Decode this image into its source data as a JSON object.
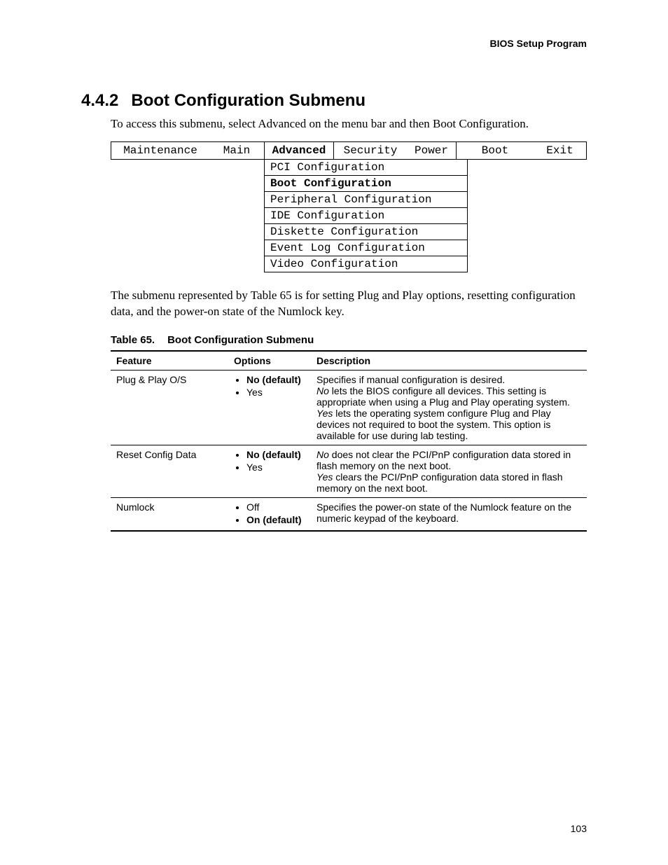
{
  "header": {
    "running": "BIOS Setup Program"
  },
  "section": {
    "number": "4.4.2",
    "title": "Boot Configuration Submenu",
    "intro": "To access this submenu, select Advanced on the menu bar and then Boot Configuration."
  },
  "menubar": {
    "items": [
      "Maintenance",
      "Main",
      "Advanced",
      "Security",
      "Power",
      "Boot",
      "Exit"
    ],
    "active": "Advanced"
  },
  "submenu": {
    "items": [
      {
        "label": "PCI Configuration",
        "selected": false
      },
      {
        "label": "Boot Configuration",
        "selected": true
      },
      {
        "label": "Peripheral Configuration",
        "selected": false
      },
      {
        "label": "IDE Configuration",
        "selected": false
      },
      {
        "label": "Diskette Configuration",
        "selected": false
      },
      {
        "label": "Event Log Configuration",
        "selected": false
      },
      {
        "label": "Video Configuration",
        "selected": false
      }
    ]
  },
  "body_after_diagram": "The submenu represented by Table 65 is for setting Plug and Play options, resetting configuration data, and the power-on state of the Numlock key.",
  "table": {
    "number": "Table 65.",
    "title": "Boot Configuration Submenu",
    "headers": [
      "Feature",
      "Options",
      "Description"
    ],
    "rows": [
      {
        "feature": "Plug & Play O/S",
        "options": [
          {
            "text": "No (default)",
            "default": true
          },
          {
            "text": "Yes",
            "default": false
          }
        ],
        "description": [
          {
            "text": "Specifies if manual configuration is desired."
          },
          {
            "lead_italic": "No",
            "rest": " lets the BIOS configure all devices.  This setting is appropriate when using a Plug and Play operating system."
          },
          {
            "lead_italic": "Yes",
            "rest": " lets the operating system configure Plug and Play devices not required to boot the system.  This option is available for use during lab testing."
          }
        ]
      },
      {
        "feature": "Reset Config Data",
        "options": [
          {
            "text": "No (default)",
            "default": true
          },
          {
            "text": "Yes",
            "default": false
          }
        ],
        "description": [
          {
            "lead_italic": "No",
            "rest": " does not clear the PCI/PnP configuration data stored in flash memory on the next boot."
          },
          {
            "lead_italic": "Yes",
            "rest": " clears the PCI/PnP configuration data stored in flash memory on the next boot."
          }
        ]
      },
      {
        "feature": "Numlock",
        "options": [
          {
            "text": "Off",
            "default": false
          },
          {
            "text": "On (default)",
            "default": true
          }
        ],
        "description": [
          {
            "text": "Specifies the power-on state of the Numlock feature on the numeric keypad of the keyboard."
          }
        ]
      }
    ]
  },
  "page_number": "103"
}
